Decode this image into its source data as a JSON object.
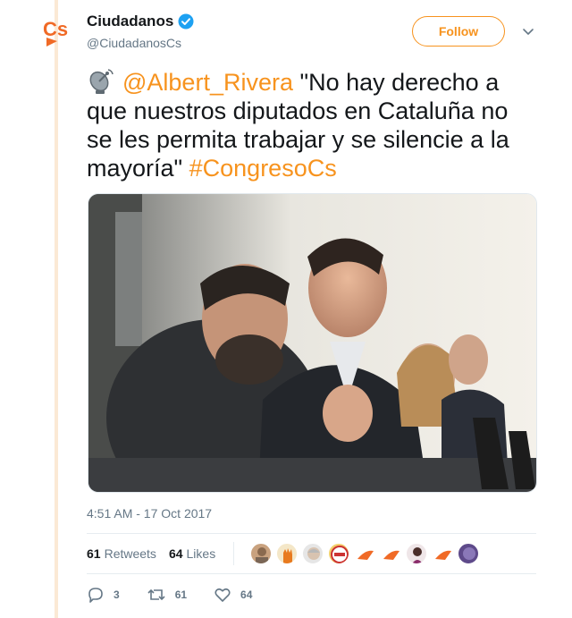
{
  "account": {
    "display_name": "Ciudadanos",
    "handle": "@CiudadanosCs",
    "verified_icon": "verified-badge-icon",
    "logo_icon": "cs-logo-icon"
  },
  "follow_button": {
    "label": "Follow"
  },
  "tweet": {
    "emoji": "satellite-antenna-icon",
    "mention": "@Albert_Rivera",
    "text": " \"No hay derecho a que nuestros diputados en Cataluña no se les permita trabajar y se silencie a la mayoría\" ",
    "hashtag": "#CongresoCs"
  },
  "timestamp": "4:51 AM - 17 Oct 2017",
  "stats": {
    "retweets_count": "61",
    "retweets_label": "Retweets",
    "likes_count": "64",
    "likes_label": "Likes"
  },
  "actions": {
    "replies": "3",
    "retweets": "61",
    "likes": "64"
  },
  "colors": {
    "accent": "#f7931e",
    "text": "#14171a",
    "muted": "#657786",
    "thread_line": "#fbe9d5",
    "verified": "#1da1f2"
  }
}
